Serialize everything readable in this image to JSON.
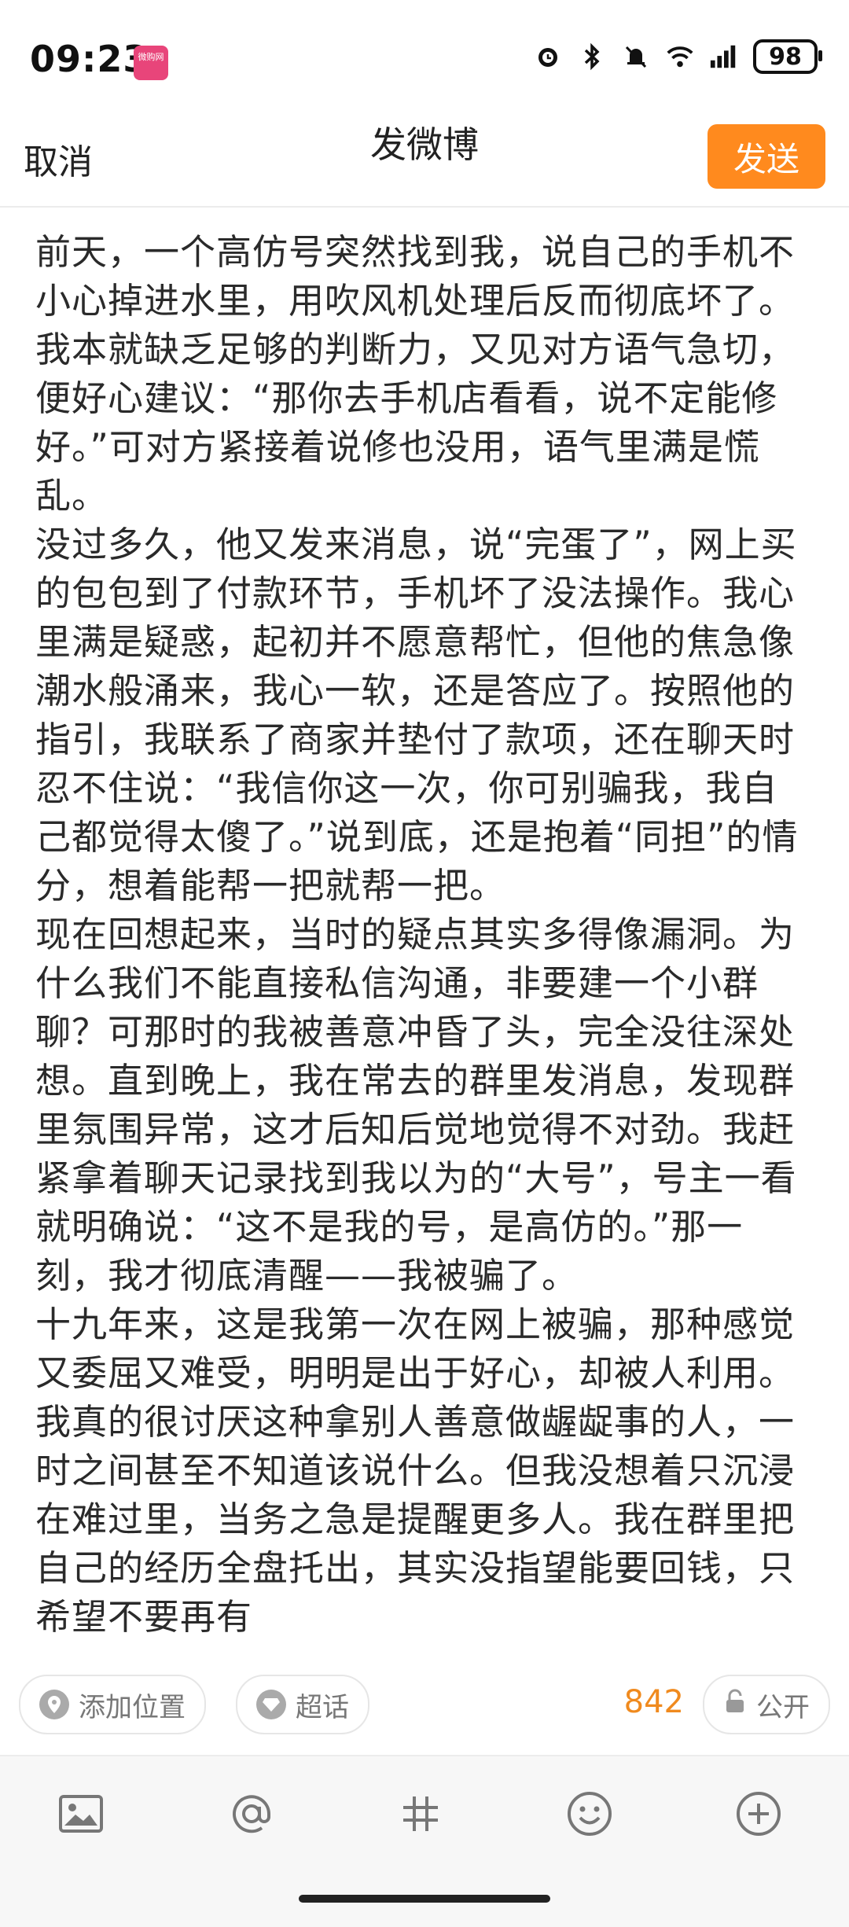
{
  "status_bar": {
    "time": "09:23",
    "app_badge": "微购网",
    "battery": "98"
  },
  "header": {
    "cancel_label": "取消",
    "title": "发微博",
    "subtitle": "",
    "send_label": "发送"
  },
  "post": {
    "paragraphs": [
      "前天，一个高仿号突然找到我，说自己的手机不小心掉进水里，用吹风机处理后反而彻底坏了。我本就缺乏足够的判断力，又见对方语气急切，便好心建议：“那你去手机店看看，说不定能修好。”可对方紧接着说修也没用，语气里满是慌乱。",
      "没过多久，他又发来消息，说“完蛋了”，网上买的包包到了付款环节，手机坏了没法操作。我心里满是疑惑，起初并不愿意帮忙，但他的焦急像潮水般涌来，我心一软，还是答应了。按照他的指引，我联系了商家并垫付了款项，还在聊天时忍不住说：“我信你这一次，你可别骗我，我自己都觉得太傻了。”说到底，还是抱着“同担”的情分，想着能帮一把就帮一把。",
      "现在回想起来，当时的疑点其实多得像漏洞。为什么我们不能直接私信沟通，非要建一个小群聊？可那时的我被善意冲昏了头，完全没往深处想。直到晚上，我在常去的群里发消息，发现群里氛围异常，这才后知后觉地觉得不对劲。我赶紧拿着聊天记录找到我以为的“大号”，号主一看就明确说：“这不是我的号，是高仿的。”那一刻，我才彻底清醒——我被骗了。",
      "十九年来，这是我第一次在网上被骗，那种感觉又委屈又难受，明明是出于好心，却被人利用。我真的很讨厌这种拿别人善意做龌龊事的人，一时之间甚至不知道该说什么。但我没想着只沉浸在难过里，当务之急是提醒更多人。我在群里把自己的经历全盘托出，其实没指望能要回钱，只希望不要再有"
    ]
  },
  "tags": {
    "location_label": "添加位置",
    "topic_label": "超话",
    "char_count": "842",
    "visibility_label": "公开"
  },
  "toolbar": {
    "items": [
      "image-icon",
      "mention-icon",
      "hashtag-icon",
      "emoji-icon",
      "add-icon"
    ]
  },
  "colors": {
    "accent": "#ff8a1e",
    "count": "#f08a1e"
  }
}
